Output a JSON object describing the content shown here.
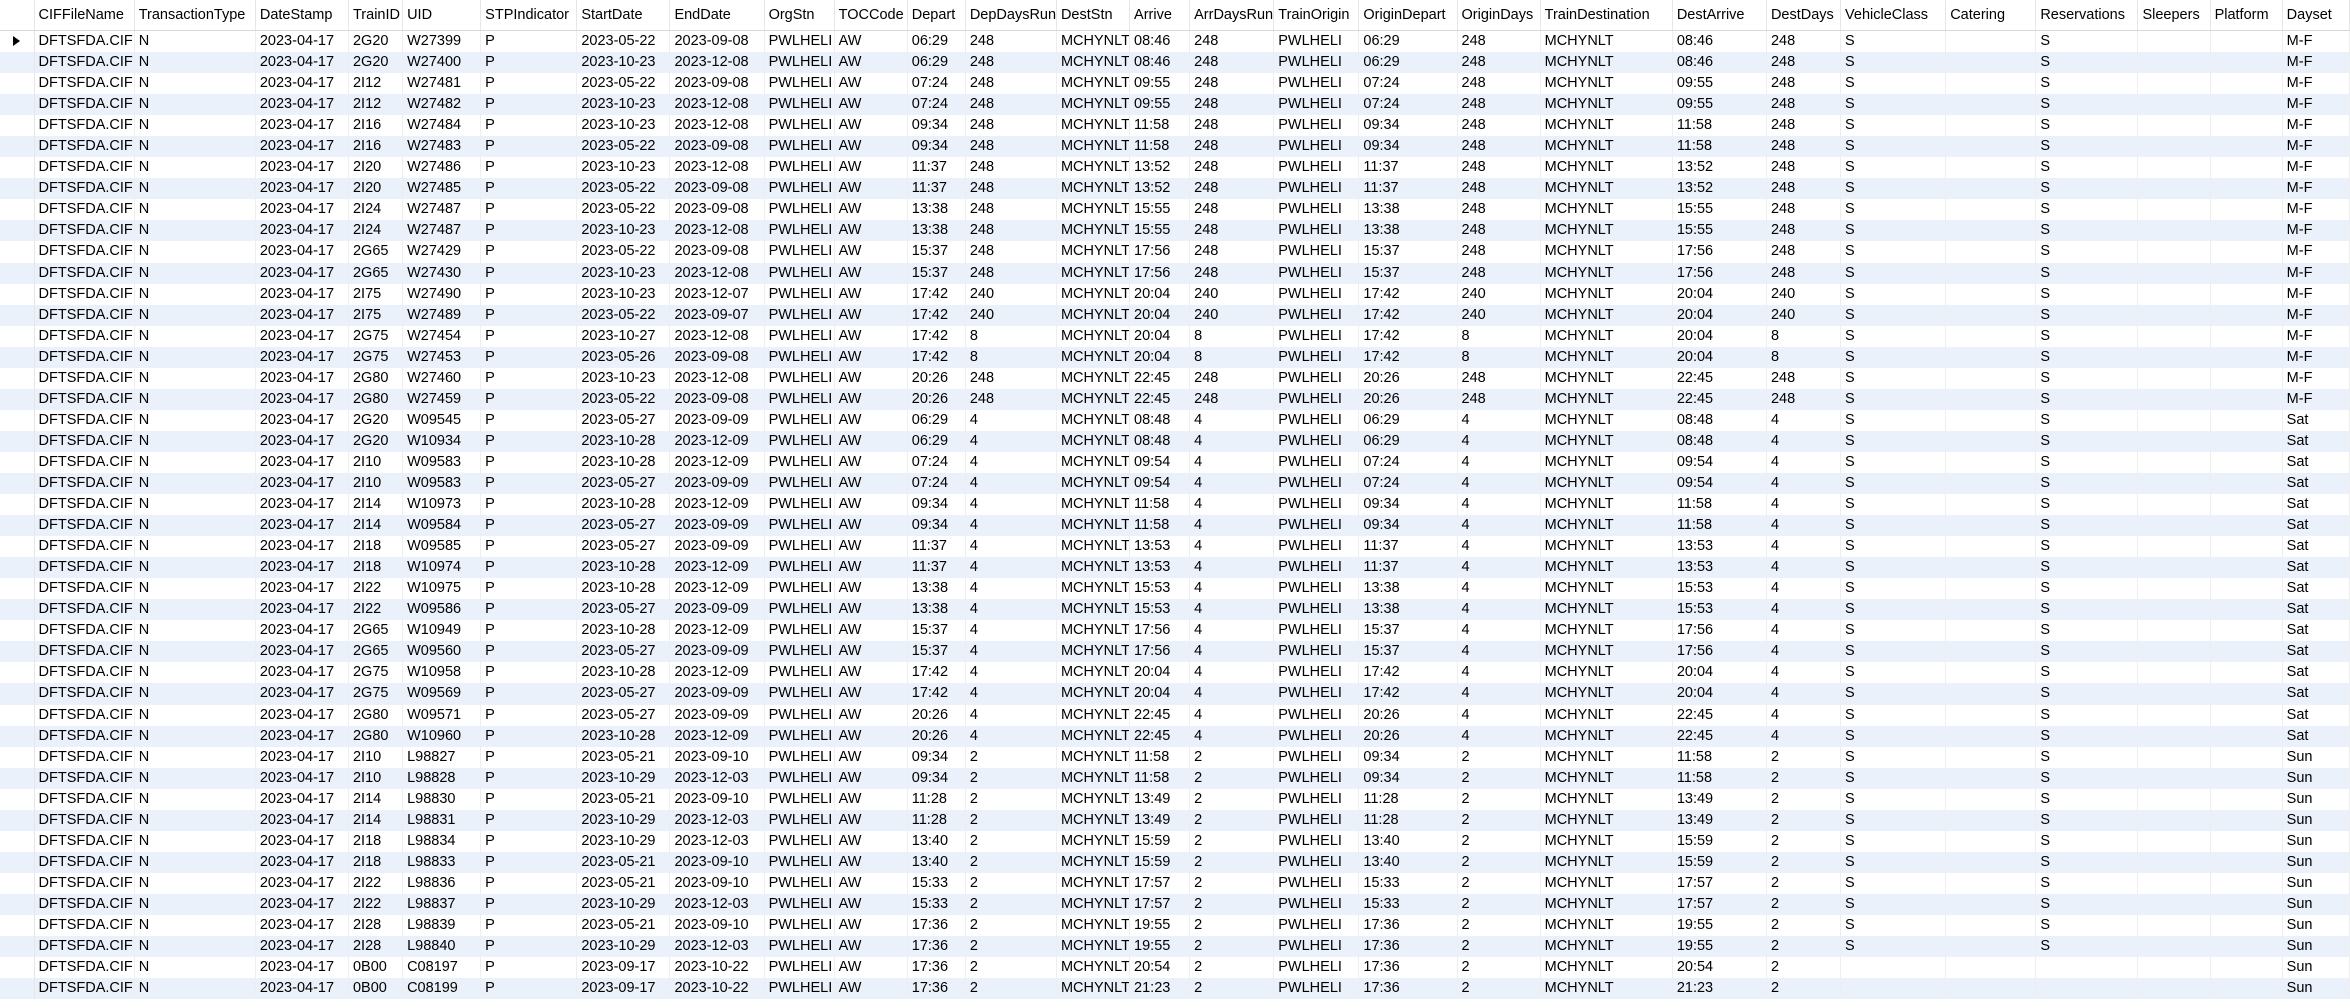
{
  "columns": [
    "CIFFileName",
    "TransactionType",
    "DateStamp",
    "TrainID",
    "UID",
    "STPIndicator",
    "StartDate",
    "EndDate",
    "OrgStn",
    "TOCCode",
    "Depart",
    "DepDaysRun",
    "DestStn",
    "Arrive",
    "ArrDaysRun",
    "TrainOrigin",
    "OriginDepart",
    "OriginDays",
    "TrainDestination",
    "DestArrive",
    "DestDays",
    "VehicleClass",
    "Catering",
    "Reservations",
    "Sleepers",
    "Platform",
    "Dayset"
  ],
  "rows": [
    [
      "DFTSFDA.CIF",
      "N",
      "2023-04-17",
      "2G20",
      "W27399",
      "P",
      "2023-05-22",
      "2023-09-08",
      "PWLHELI",
      "AW",
      "06:29",
      "248",
      "MCHYNLT",
      "08:46",
      "248",
      "PWLHELI",
      "06:29",
      "248",
      "MCHYNLT",
      "08:46",
      "248",
      "S",
      "",
      "S",
      "",
      "",
      "M-F"
    ],
    [
      "DFTSFDA.CIF",
      "N",
      "2023-04-17",
      "2G20",
      "W27400",
      "P",
      "2023-10-23",
      "2023-12-08",
      "PWLHELI",
      "AW",
      "06:29",
      "248",
      "MCHYNLT",
      "08:46",
      "248",
      "PWLHELI",
      "06:29",
      "248",
      "MCHYNLT",
      "08:46",
      "248",
      "S",
      "",
      "S",
      "",
      "",
      "M-F"
    ],
    [
      "DFTSFDA.CIF",
      "N",
      "2023-04-17",
      "2I12",
      "W27481",
      "P",
      "2023-05-22",
      "2023-09-08",
      "PWLHELI",
      "AW",
      "07:24",
      "248",
      "MCHYNLT",
      "09:55",
      "248",
      "PWLHELI",
      "07:24",
      "248",
      "MCHYNLT",
      "09:55",
      "248",
      "S",
      "",
      "S",
      "",
      "",
      "M-F"
    ],
    [
      "DFTSFDA.CIF",
      "N",
      "2023-04-17",
      "2I12",
      "W27482",
      "P",
      "2023-10-23",
      "2023-12-08",
      "PWLHELI",
      "AW",
      "07:24",
      "248",
      "MCHYNLT",
      "09:55",
      "248",
      "PWLHELI",
      "07:24",
      "248",
      "MCHYNLT",
      "09:55",
      "248",
      "S",
      "",
      "S",
      "",
      "",
      "M-F"
    ],
    [
      "DFTSFDA.CIF",
      "N",
      "2023-04-17",
      "2I16",
      "W27484",
      "P",
      "2023-10-23",
      "2023-12-08",
      "PWLHELI",
      "AW",
      "09:34",
      "248",
      "MCHYNLT",
      "11:58",
      "248",
      "PWLHELI",
      "09:34",
      "248",
      "MCHYNLT",
      "11:58",
      "248",
      "S",
      "",
      "S",
      "",
      "",
      "M-F"
    ],
    [
      "DFTSFDA.CIF",
      "N",
      "2023-04-17",
      "2I16",
      "W27483",
      "P",
      "2023-05-22",
      "2023-09-08",
      "PWLHELI",
      "AW",
      "09:34",
      "248",
      "MCHYNLT",
      "11:58",
      "248",
      "PWLHELI",
      "09:34",
      "248",
      "MCHYNLT",
      "11:58",
      "248",
      "S",
      "",
      "S",
      "",
      "",
      "M-F"
    ],
    [
      "DFTSFDA.CIF",
      "N",
      "2023-04-17",
      "2I20",
      "W27486",
      "P",
      "2023-10-23",
      "2023-12-08",
      "PWLHELI",
      "AW",
      "11:37",
      "248",
      "MCHYNLT",
      "13:52",
      "248",
      "PWLHELI",
      "11:37",
      "248",
      "MCHYNLT",
      "13:52",
      "248",
      "S",
      "",
      "S",
      "",
      "",
      "M-F"
    ],
    [
      "DFTSFDA.CIF",
      "N",
      "2023-04-17",
      "2I20",
      "W27485",
      "P",
      "2023-05-22",
      "2023-09-08",
      "PWLHELI",
      "AW",
      "11:37",
      "248",
      "MCHYNLT",
      "13:52",
      "248",
      "PWLHELI",
      "11:37",
      "248",
      "MCHYNLT",
      "13:52",
      "248",
      "S",
      "",
      "S",
      "",
      "",
      "M-F"
    ],
    [
      "DFTSFDA.CIF",
      "N",
      "2023-04-17",
      "2I24",
      "W27487",
      "P",
      "2023-05-22",
      "2023-09-08",
      "PWLHELI",
      "AW",
      "13:38",
      "248",
      "MCHYNLT",
      "15:55",
      "248",
      "PWLHELI",
      "13:38",
      "248",
      "MCHYNLT",
      "15:55",
      "248",
      "S",
      "",
      "S",
      "",
      "",
      "M-F"
    ],
    [
      "DFTSFDA.CIF",
      "N",
      "2023-04-17",
      "2I24",
      "W27487",
      "P",
      "2023-10-23",
      "2023-12-08",
      "PWLHELI",
      "AW",
      "13:38",
      "248",
      "MCHYNLT",
      "15:55",
      "248",
      "PWLHELI",
      "13:38",
      "248",
      "MCHYNLT",
      "15:55",
      "248",
      "S",
      "",
      "S",
      "",
      "",
      "M-F"
    ],
    [
      "DFTSFDA.CIF",
      "N",
      "2023-04-17",
      "2G65",
      "W27429",
      "P",
      "2023-05-22",
      "2023-09-08",
      "PWLHELI",
      "AW",
      "15:37",
      "248",
      "MCHYNLT",
      "17:56",
      "248",
      "PWLHELI",
      "15:37",
      "248",
      "MCHYNLT",
      "17:56",
      "248",
      "S",
      "",
      "S",
      "",
      "",
      "M-F"
    ],
    [
      "DFTSFDA.CIF",
      "N",
      "2023-04-17",
      "2G65",
      "W27430",
      "P",
      "2023-10-23",
      "2023-12-08",
      "PWLHELI",
      "AW",
      "15:37",
      "248",
      "MCHYNLT",
      "17:56",
      "248",
      "PWLHELI",
      "15:37",
      "248",
      "MCHYNLT",
      "17:56",
      "248",
      "S",
      "",
      "S",
      "",
      "",
      "M-F"
    ],
    [
      "DFTSFDA.CIF",
      "N",
      "2023-04-17",
      "2I75",
      "W27490",
      "P",
      "2023-10-23",
      "2023-12-07",
      "PWLHELI",
      "AW",
      "17:42",
      "240",
      "MCHYNLT",
      "20:04",
      "240",
      "PWLHELI",
      "17:42",
      "240",
      "MCHYNLT",
      "20:04",
      "240",
      "S",
      "",
      "S",
      "",
      "",
      "M-F"
    ],
    [
      "DFTSFDA.CIF",
      "N",
      "2023-04-17",
      "2I75",
      "W27489",
      "P",
      "2023-05-22",
      "2023-09-07",
      "PWLHELI",
      "AW",
      "17:42",
      "240",
      "MCHYNLT",
      "20:04",
      "240",
      "PWLHELI",
      "17:42",
      "240",
      "MCHYNLT",
      "20:04",
      "240",
      "S",
      "",
      "S",
      "",
      "",
      "M-F"
    ],
    [
      "DFTSFDA.CIF",
      "N",
      "2023-04-17",
      "2G75",
      "W27454",
      "P",
      "2023-10-27",
      "2023-12-08",
      "PWLHELI",
      "AW",
      "17:42",
      "8",
      "MCHYNLT",
      "20:04",
      "8",
      "PWLHELI",
      "17:42",
      "8",
      "MCHYNLT",
      "20:04",
      "8",
      "S",
      "",
      "S",
      "",
      "",
      "M-F"
    ],
    [
      "DFTSFDA.CIF",
      "N",
      "2023-04-17",
      "2G75",
      "W27453",
      "P",
      "2023-05-26",
      "2023-09-08",
      "PWLHELI",
      "AW",
      "17:42",
      "8",
      "MCHYNLT",
      "20:04",
      "8",
      "PWLHELI",
      "17:42",
      "8",
      "MCHYNLT",
      "20:04",
      "8",
      "S",
      "",
      "S",
      "",
      "",
      "M-F"
    ],
    [
      "DFTSFDA.CIF",
      "N",
      "2023-04-17",
      "2G80",
      "W27460",
      "P",
      "2023-10-23",
      "2023-12-08",
      "PWLHELI",
      "AW",
      "20:26",
      "248",
      "MCHYNLT",
      "22:45",
      "248",
      "PWLHELI",
      "20:26",
      "248",
      "MCHYNLT",
      "22:45",
      "248",
      "S",
      "",
      "S",
      "",
      "",
      "M-F"
    ],
    [
      "DFTSFDA.CIF",
      "N",
      "2023-04-17",
      "2G80",
      "W27459",
      "P",
      "2023-05-22",
      "2023-09-08",
      "PWLHELI",
      "AW",
      "20:26",
      "248",
      "MCHYNLT",
      "22:45",
      "248",
      "PWLHELI",
      "20:26",
      "248",
      "MCHYNLT",
      "22:45",
      "248",
      "S",
      "",
      "S",
      "",
      "",
      "M-F"
    ],
    [
      "DFTSFDA.CIF",
      "N",
      "2023-04-17",
      "2G20",
      "W09545",
      "P",
      "2023-05-27",
      "2023-09-09",
      "PWLHELI",
      "AW",
      "06:29",
      "4",
      "MCHYNLT",
      "08:48",
      "4",
      "PWLHELI",
      "06:29",
      "4",
      "MCHYNLT",
      "08:48",
      "4",
      "S",
      "",
      "S",
      "",
      "",
      "Sat"
    ],
    [
      "DFTSFDA.CIF",
      "N",
      "2023-04-17",
      "2G20",
      "W10934",
      "P",
      "2023-10-28",
      "2023-12-09",
      "PWLHELI",
      "AW",
      "06:29",
      "4",
      "MCHYNLT",
      "08:48",
      "4",
      "PWLHELI",
      "06:29",
      "4",
      "MCHYNLT",
      "08:48",
      "4",
      "S",
      "",
      "S",
      "",
      "",
      "Sat"
    ],
    [
      "DFTSFDA.CIF",
      "N",
      "2023-04-17",
      "2I10",
      "W09583",
      "P",
      "2023-10-28",
      "2023-12-09",
      "PWLHELI",
      "AW",
      "07:24",
      "4",
      "MCHYNLT",
      "09:54",
      "4",
      "PWLHELI",
      "07:24",
      "4",
      "MCHYNLT",
      "09:54",
      "4",
      "S",
      "",
      "S",
      "",
      "",
      "Sat"
    ],
    [
      "DFTSFDA.CIF",
      "N",
      "2023-04-17",
      "2I10",
      "W09583",
      "P",
      "2023-05-27",
      "2023-09-09",
      "PWLHELI",
      "AW",
      "07:24",
      "4",
      "MCHYNLT",
      "09:54",
      "4",
      "PWLHELI",
      "07:24",
      "4",
      "MCHYNLT",
      "09:54",
      "4",
      "S",
      "",
      "S",
      "",
      "",
      "Sat"
    ],
    [
      "DFTSFDA.CIF",
      "N",
      "2023-04-17",
      "2I14",
      "W10973",
      "P",
      "2023-10-28",
      "2023-12-09",
      "PWLHELI",
      "AW",
      "09:34",
      "4",
      "MCHYNLT",
      "11:58",
      "4",
      "PWLHELI",
      "09:34",
      "4",
      "MCHYNLT",
      "11:58",
      "4",
      "S",
      "",
      "S",
      "",
      "",
      "Sat"
    ],
    [
      "DFTSFDA.CIF",
      "N",
      "2023-04-17",
      "2I14",
      "W09584",
      "P",
      "2023-05-27",
      "2023-09-09",
      "PWLHELI",
      "AW",
      "09:34",
      "4",
      "MCHYNLT",
      "11:58",
      "4",
      "PWLHELI",
      "09:34",
      "4",
      "MCHYNLT",
      "11:58",
      "4",
      "S",
      "",
      "S",
      "",
      "",
      "Sat"
    ],
    [
      "DFTSFDA.CIF",
      "N",
      "2023-04-17",
      "2I18",
      "W09585",
      "P",
      "2023-05-27",
      "2023-09-09",
      "PWLHELI",
      "AW",
      "11:37",
      "4",
      "MCHYNLT",
      "13:53",
      "4",
      "PWLHELI",
      "11:37",
      "4",
      "MCHYNLT",
      "13:53",
      "4",
      "S",
      "",
      "S",
      "",
      "",
      "Sat"
    ],
    [
      "DFTSFDA.CIF",
      "N",
      "2023-04-17",
      "2I18",
      "W10974",
      "P",
      "2023-10-28",
      "2023-12-09",
      "PWLHELI",
      "AW",
      "11:37",
      "4",
      "MCHYNLT",
      "13:53",
      "4",
      "PWLHELI",
      "11:37",
      "4",
      "MCHYNLT",
      "13:53",
      "4",
      "S",
      "",
      "S",
      "",
      "",
      "Sat"
    ],
    [
      "DFTSFDA.CIF",
      "N",
      "2023-04-17",
      "2I22",
      "W10975",
      "P",
      "2023-10-28",
      "2023-12-09",
      "PWLHELI",
      "AW",
      "13:38",
      "4",
      "MCHYNLT",
      "15:53",
      "4",
      "PWLHELI",
      "13:38",
      "4",
      "MCHYNLT",
      "15:53",
      "4",
      "S",
      "",
      "S",
      "",
      "",
      "Sat"
    ],
    [
      "DFTSFDA.CIF",
      "N",
      "2023-04-17",
      "2I22",
      "W09586",
      "P",
      "2023-05-27",
      "2023-09-09",
      "PWLHELI",
      "AW",
      "13:38",
      "4",
      "MCHYNLT",
      "15:53",
      "4",
      "PWLHELI",
      "13:38",
      "4",
      "MCHYNLT",
      "15:53",
      "4",
      "S",
      "",
      "S",
      "",
      "",
      "Sat"
    ],
    [
      "DFTSFDA.CIF",
      "N",
      "2023-04-17",
      "2G65",
      "W10949",
      "P",
      "2023-10-28",
      "2023-12-09",
      "PWLHELI",
      "AW",
      "15:37",
      "4",
      "MCHYNLT",
      "17:56",
      "4",
      "PWLHELI",
      "15:37",
      "4",
      "MCHYNLT",
      "17:56",
      "4",
      "S",
      "",
      "S",
      "",
      "",
      "Sat"
    ],
    [
      "DFTSFDA.CIF",
      "N",
      "2023-04-17",
      "2G65",
      "W09560",
      "P",
      "2023-05-27",
      "2023-09-09",
      "PWLHELI",
      "AW",
      "15:37",
      "4",
      "MCHYNLT",
      "17:56",
      "4",
      "PWLHELI",
      "15:37",
      "4",
      "MCHYNLT",
      "17:56",
      "4",
      "S",
      "",
      "S",
      "",
      "",
      "Sat"
    ],
    [
      "DFTSFDA.CIF",
      "N",
      "2023-04-17",
      "2G75",
      "W10958",
      "P",
      "2023-10-28",
      "2023-12-09",
      "PWLHELI",
      "AW",
      "17:42",
      "4",
      "MCHYNLT",
      "20:04",
      "4",
      "PWLHELI",
      "17:42",
      "4",
      "MCHYNLT",
      "20:04",
      "4",
      "S",
      "",
      "S",
      "",
      "",
      "Sat"
    ],
    [
      "DFTSFDA.CIF",
      "N",
      "2023-04-17",
      "2G75",
      "W09569",
      "P",
      "2023-05-27",
      "2023-09-09",
      "PWLHELI",
      "AW",
      "17:42",
      "4",
      "MCHYNLT",
      "20:04",
      "4",
      "PWLHELI",
      "17:42",
      "4",
      "MCHYNLT",
      "20:04",
      "4",
      "S",
      "",
      "S",
      "",
      "",
      "Sat"
    ],
    [
      "DFTSFDA.CIF",
      "N",
      "2023-04-17",
      "2G80",
      "W09571",
      "P",
      "2023-05-27",
      "2023-09-09",
      "PWLHELI",
      "AW",
      "20:26",
      "4",
      "MCHYNLT",
      "22:45",
      "4",
      "PWLHELI",
      "20:26",
      "4",
      "MCHYNLT",
      "22:45",
      "4",
      "S",
      "",
      "S",
      "",
      "",
      "Sat"
    ],
    [
      "DFTSFDA.CIF",
      "N",
      "2023-04-17",
      "2G80",
      "W10960",
      "P",
      "2023-10-28",
      "2023-12-09",
      "PWLHELI",
      "AW",
      "20:26",
      "4",
      "MCHYNLT",
      "22:45",
      "4",
      "PWLHELI",
      "20:26",
      "4",
      "MCHYNLT",
      "22:45",
      "4",
      "S",
      "",
      "S",
      "",
      "",
      "Sat"
    ],
    [
      "DFTSFDA.CIF",
      "N",
      "2023-04-17",
      "2I10",
      "L98827",
      "P",
      "2023-05-21",
      "2023-09-10",
      "PWLHELI",
      "AW",
      "09:34",
      "2",
      "MCHYNLT",
      "11:58",
      "2",
      "PWLHELI",
      "09:34",
      "2",
      "MCHYNLT",
      "11:58",
      "2",
      "S",
      "",
      "S",
      "",
      "",
      "Sun"
    ],
    [
      "DFTSFDA.CIF",
      "N",
      "2023-04-17",
      "2I10",
      "L98828",
      "P",
      "2023-10-29",
      "2023-12-03",
      "PWLHELI",
      "AW",
      "09:34",
      "2",
      "MCHYNLT",
      "11:58",
      "2",
      "PWLHELI",
      "09:34",
      "2",
      "MCHYNLT",
      "11:58",
      "2",
      "S",
      "",
      "S",
      "",
      "",
      "Sun"
    ],
    [
      "DFTSFDA.CIF",
      "N",
      "2023-04-17",
      "2I14",
      "L98830",
      "P",
      "2023-05-21",
      "2023-09-10",
      "PWLHELI",
      "AW",
      "11:28",
      "2",
      "MCHYNLT",
      "13:49",
      "2",
      "PWLHELI",
      "11:28",
      "2",
      "MCHYNLT",
      "13:49",
      "2",
      "S",
      "",
      "S",
      "",
      "",
      "Sun"
    ],
    [
      "DFTSFDA.CIF",
      "N",
      "2023-04-17",
      "2I14",
      "L98831",
      "P",
      "2023-10-29",
      "2023-12-03",
      "PWLHELI",
      "AW",
      "11:28",
      "2",
      "MCHYNLT",
      "13:49",
      "2",
      "PWLHELI",
      "11:28",
      "2",
      "MCHYNLT",
      "13:49",
      "2",
      "S",
      "",
      "S",
      "",
      "",
      "Sun"
    ],
    [
      "DFTSFDA.CIF",
      "N",
      "2023-04-17",
      "2I18",
      "L98834",
      "P",
      "2023-10-29",
      "2023-12-03",
      "PWLHELI",
      "AW",
      "13:40",
      "2",
      "MCHYNLT",
      "15:59",
      "2",
      "PWLHELI",
      "13:40",
      "2",
      "MCHYNLT",
      "15:59",
      "2",
      "S",
      "",
      "S",
      "",
      "",
      "Sun"
    ],
    [
      "DFTSFDA.CIF",
      "N",
      "2023-04-17",
      "2I18",
      "L98833",
      "P",
      "2023-05-21",
      "2023-09-10",
      "PWLHELI",
      "AW",
      "13:40",
      "2",
      "MCHYNLT",
      "15:59",
      "2",
      "PWLHELI",
      "13:40",
      "2",
      "MCHYNLT",
      "15:59",
      "2",
      "S",
      "",
      "S",
      "",
      "",
      "Sun"
    ],
    [
      "DFTSFDA.CIF",
      "N",
      "2023-04-17",
      "2I22",
      "L98836",
      "P",
      "2023-05-21",
      "2023-09-10",
      "PWLHELI",
      "AW",
      "15:33",
      "2",
      "MCHYNLT",
      "17:57",
      "2",
      "PWLHELI",
      "15:33",
      "2",
      "MCHYNLT",
      "17:57",
      "2",
      "S",
      "",
      "S",
      "",
      "",
      "Sun"
    ],
    [
      "DFTSFDA.CIF",
      "N",
      "2023-04-17",
      "2I22",
      "L98837",
      "P",
      "2023-10-29",
      "2023-12-03",
      "PWLHELI",
      "AW",
      "15:33",
      "2",
      "MCHYNLT",
      "17:57",
      "2",
      "PWLHELI",
      "15:33",
      "2",
      "MCHYNLT",
      "17:57",
      "2",
      "S",
      "",
      "S",
      "",
      "",
      "Sun"
    ],
    [
      "DFTSFDA.CIF",
      "N",
      "2023-04-17",
      "2I28",
      "L98839",
      "P",
      "2023-05-21",
      "2023-09-10",
      "PWLHELI",
      "AW",
      "17:36",
      "2",
      "MCHYNLT",
      "19:55",
      "2",
      "PWLHELI",
      "17:36",
      "2",
      "MCHYNLT",
      "19:55",
      "2",
      "S",
      "",
      "S",
      "",
      "",
      "Sun"
    ],
    [
      "DFTSFDA.CIF",
      "N",
      "2023-04-17",
      "2I28",
      "L98840",
      "P",
      "2023-10-29",
      "2023-12-03",
      "PWLHELI",
      "AW",
      "17:36",
      "2",
      "MCHYNLT",
      "19:55",
      "2",
      "PWLHELI",
      "17:36",
      "2",
      "MCHYNLT",
      "19:55",
      "2",
      "S",
      "",
      "S",
      "",
      "",
      "Sun"
    ],
    [
      "DFTSFDA.CIF",
      "N",
      "2023-04-17",
      "0B00",
      "C08197",
      "P",
      "2023-09-17",
      "2023-10-22",
      "PWLHELI",
      "AW",
      "17:36",
      "2",
      "MCHYNLT",
      "20:54",
      "2",
      "PWLHELI",
      "17:36",
      "2",
      "MCHYNLT",
      "20:54",
      "2",
      "",
      "",
      "",
      "",
      "",
      "Sun"
    ],
    [
      "DFTSFDA.CIF",
      "N",
      "2023-04-17",
      "0B00",
      "C08199",
      "P",
      "2023-09-17",
      "2023-10-22",
      "PWLHELI",
      "AW",
      "17:36",
      "2",
      "MCHYNLT",
      "21:23",
      "2",
      "PWLHELI",
      "17:36",
      "2",
      "MCHYNLT",
      "21:23",
      "2",
      "",
      "",
      "",
      "",
      "",
      "Sun"
    ]
  ],
  "selected_row_indicator": "row-caret-icon"
}
